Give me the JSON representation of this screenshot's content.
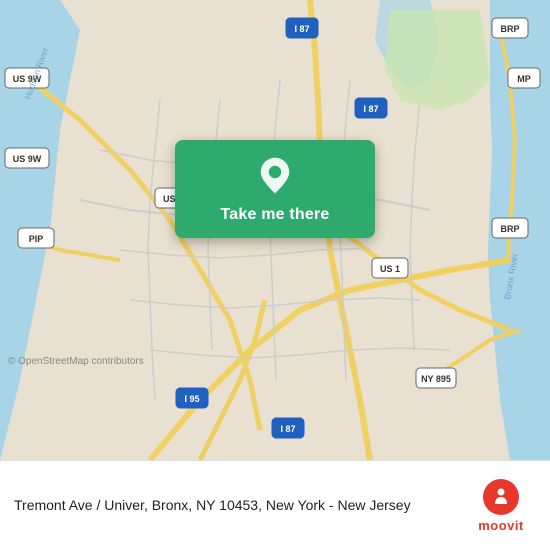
{
  "map": {
    "attribution": "© OpenStreetMap contributors",
    "center": {
      "lat": 40.85,
      "lng": -73.9
    }
  },
  "card": {
    "button_label": "Take me there",
    "pin_icon": "location-pin-icon"
  },
  "bottom_bar": {
    "location_text": "Tremont Ave / Univer, Bronx, NY 10453, New York - New Jersey",
    "attribution": "© OpenStreetMap contributors",
    "moovit_label": "moovit"
  }
}
